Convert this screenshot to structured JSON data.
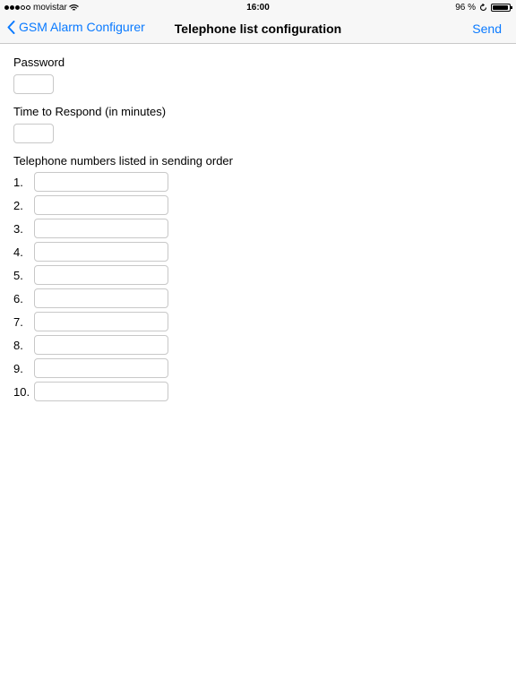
{
  "status": {
    "carrier": "movistar",
    "time": "16:00",
    "battery": "96 %",
    "battery_level": 0.96
  },
  "nav": {
    "back_label": "GSM Alarm Configurer",
    "title": "Telephone list configuration",
    "send_label": "Send"
  },
  "form": {
    "password_label": "Password",
    "time_label": "Time to Respond (in minutes)",
    "phones_label": "Telephone numbers listed in sending order",
    "phones": [
      "1.",
      "2.",
      "3.",
      "4.",
      "5.",
      "6.",
      "7.",
      "8.",
      "9.",
      "10."
    ]
  },
  "icons": {
    "signal": "signal-dots-icon",
    "wifi": "wifi-icon",
    "orientation_lock": "orientation-lock-icon",
    "battery": "battery-icon",
    "back": "chevron-left-icon"
  },
  "colors": {
    "accent": "#0a7aff"
  }
}
